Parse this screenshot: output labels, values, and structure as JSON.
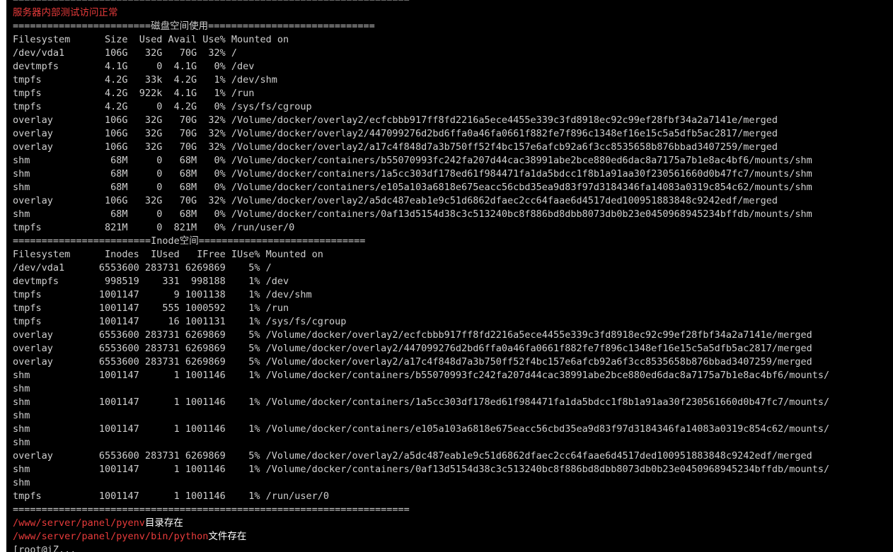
{
  "terminal": {
    "lines": [
      {
        "segments": [
          {
            "text": "=====================================================================",
            "color": "dim"
          }
        ]
      },
      {
        "segments": [
          {
            "text": "服务器内部测试访问正常",
            "color": "red"
          }
        ]
      },
      {
        "segments": [
          {
            "text": "========================磁盘空间使用=============================",
            "color": "dim"
          }
        ]
      },
      {
        "segments": [
          {
            "text": "Filesystem      Size  Used Avail Use% Mounted on",
            "color": "dim"
          }
        ]
      },
      {
        "segments": [
          {
            "text": "/dev/vda1       106G   32G   70G  32% /",
            "color": "dim"
          }
        ]
      },
      {
        "segments": [
          {
            "text": "devtmpfs        4.1G     0  4.1G   0% /dev",
            "color": "dim"
          }
        ]
      },
      {
        "segments": [
          {
            "text": "tmpfs           4.2G   33k  4.2G   1% /dev/shm",
            "color": "dim"
          }
        ]
      },
      {
        "segments": [
          {
            "text": "tmpfs           4.2G  922k  4.1G   1% /run",
            "color": "dim"
          }
        ]
      },
      {
        "segments": [
          {
            "text": "tmpfs           4.2G     0  4.2G   0% /sys/fs/cgroup",
            "color": "dim"
          }
        ]
      },
      {
        "segments": [
          {
            "text": "overlay         106G   32G   70G  32% /Volume/docker/overlay2/ecfcbbb917ff8fd2216a5ece4455e339c3fd8918ec92c99ef28fbf34a2a7141e/merged",
            "color": "dim"
          }
        ]
      },
      {
        "segments": [
          {
            "text": "overlay         106G   32G   70G  32% /Volume/docker/overlay2/447099276d2bd6ffa0a46fa0661f882fe7f896c1348ef16e15c5a5dfb5ac2817/merged",
            "color": "dim"
          }
        ]
      },
      {
        "segments": [
          {
            "text": "overlay         106G   32G   70G  32% /Volume/docker/overlay2/a17c4f848d7a3b750ff52f4bc157e6afcb92a6f3cc8535658b876bbad3407259/merged",
            "color": "dim"
          }
        ]
      },
      {
        "segments": [
          {
            "text": "shm              68M     0   68M   0% /Volume/docker/containers/b55070993fc242fa207d44cac38991abe2bce880ed6dac8a7175a7b1e8ac4bf6/mounts/shm",
            "color": "dim"
          }
        ]
      },
      {
        "segments": [
          {
            "text": "shm              68M     0   68M   0% /Volume/docker/containers/1a5cc303df178ed61f984471fa1da5bdcc1f8b1a91aa30f230561660d0b47fc7/mounts/shm",
            "color": "dim"
          }
        ]
      },
      {
        "segments": [
          {
            "text": "shm              68M     0   68M   0% /Volume/docker/containers/e105a103a6818e675eacc56cbd35ea9d83f97d3184346fa14083a0319c854c62/mounts/shm",
            "color": "dim"
          }
        ]
      },
      {
        "segments": [
          {
            "text": "overlay         106G   32G   70G  32% /Volume/docker/overlay2/a5dc487eab1e9c51d6862dfaec2cc64faae6d4517ded100951883848c9242edf/merged",
            "color": "dim"
          }
        ]
      },
      {
        "segments": [
          {
            "text": "shm              68M     0   68M   0% /Volume/docker/containers/0af13d5154d38c3c513240bc8f886bd8dbb8073db0b23e0450968945234bffdb/mounts/shm",
            "color": "dim"
          }
        ]
      },
      {
        "segments": [
          {
            "text": "tmpfs           821M     0  821M   0% /run/user/0",
            "color": "dim"
          }
        ]
      },
      {
        "segments": [
          {
            "text": "========================Inode空间=============================",
            "color": "dim"
          }
        ]
      },
      {
        "segments": [
          {
            "text": "Filesystem      Inodes  IUsed   IFree IUse% Mounted on",
            "color": "dim"
          }
        ]
      },
      {
        "segments": [
          {
            "text": "/dev/vda1      6553600 283731 6269869    5% /",
            "color": "dim"
          }
        ]
      },
      {
        "segments": [
          {
            "text": "devtmpfs        998519    331  998188    1% /dev",
            "color": "dim"
          }
        ]
      },
      {
        "segments": [
          {
            "text": "tmpfs          1001147      9 1001138    1% /dev/shm",
            "color": "dim"
          }
        ]
      },
      {
        "segments": [
          {
            "text": "tmpfs          1001147    555 1000592    1% /run",
            "color": "dim"
          }
        ]
      },
      {
        "segments": [
          {
            "text": "tmpfs          1001147     16 1001131    1% /sys/fs/cgroup",
            "color": "dim"
          }
        ]
      },
      {
        "segments": [
          {
            "text": "overlay        6553600 283731 6269869    5% /Volume/docker/overlay2/ecfcbbb917ff8fd2216a5ece4455e339c3fd8918ec92c99ef28fbf34a2a7141e/merged",
            "color": "dim"
          }
        ]
      },
      {
        "segments": [
          {
            "text": "overlay        6553600 283731 6269869    5% /Volume/docker/overlay2/447099276d2bd6ffa0a46fa0661f882fe7f896c1348ef16e15c5a5dfb5ac2817/merged",
            "color": "dim"
          }
        ]
      },
      {
        "segments": [
          {
            "text": "overlay        6553600 283731 6269869    5% /Volume/docker/overlay2/a17c4f848d7a3b750ff52f4bc157e6afcb92a6f3cc8535658b876bbad3407259/merged",
            "color": "dim"
          }
        ]
      },
      {
        "segments": [
          {
            "text": "shm            1001147      1 1001146    1% /Volume/docker/containers/b55070993fc242fa207d44cac38991abe2bce880ed6dac8a7175a7b1e8ac4bf6/mounts/",
            "color": "dim"
          }
        ]
      },
      {
        "segments": [
          {
            "text": "shm",
            "color": "dim"
          }
        ]
      },
      {
        "segments": [
          {
            "text": "shm            1001147      1 1001146    1% /Volume/docker/containers/1a5cc303df178ed61f984471fa1da5bdcc1f8b1a91aa30f230561660d0b47fc7/mounts/",
            "color": "dim"
          }
        ]
      },
      {
        "segments": [
          {
            "text": "shm",
            "color": "dim"
          }
        ]
      },
      {
        "segments": [
          {
            "text": "shm            1001147      1 1001146    1% /Volume/docker/containers/e105a103a6818e675eacc56cbd35ea9d83f97d3184346fa14083a0319c854c62/mounts/",
            "color": "dim"
          }
        ]
      },
      {
        "segments": [
          {
            "text": "shm",
            "color": "dim"
          }
        ]
      },
      {
        "segments": [
          {
            "text": "overlay        6553600 283731 6269869    5% /Volume/docker/overlay2/a5dc487eab1e9c51d6862dfaec2cc64faae6d4517ded100951883848c9242edf/merged",
            "color": "dim"
          }
        ]
      },
      {
        "segments": [
          {
            "text": "shm            1001147      1 1001146    1% /Volume/docker/containers/0af13d5154d38c3c513240bc8f886bd8dbb8073db0b23e0450968945234bffdb/mounts/",
            "color": "dim"
          }
        ]
      },
      {
        "segments": [
          {
            "text": "shm",
            "color": "dim"
          }
        ]
      },
      {
        "segments": [
          {
            "text": "tmpfs          1001147      1 1001146    1% /run/user/0",
            "color": "dim"
          }
        ]
      },
      {
        "segments": [
          {
            "text": "=====================================================================",
            "color": "dim"
          }
        ]
      },
      {
        "segments": [
          {
            "text": "/www/server/panel/pyenv",
            "color": "red"
          },
          {
            "text": "目录存在",
            "color": "white"
          }
        ]
      },
      {
        "segments": [
          {
            "text": "/www/server/panel/pyenv/bin/python",
            "color": "red"
          },
          {
            "text": "文件存在",
            "color": "white"
          }
        ]
      },
      {
        "segments": [
          {
            "text": "[root@iZ...",
            "color": "dim"
          }
        ]
      }
    ]
  },
  "colors": {
    "background": "#000000",
    "text": "#d8d8d8",
    "highlight_red": "#e83b3b",
    "white": "#ffffff"
  }
}
